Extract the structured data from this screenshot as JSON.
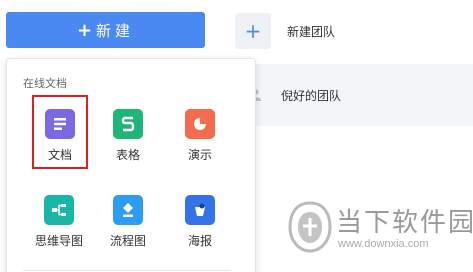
{
  "new_button": {
    "plus": "+",
    "label": "新建"
  },
  "dropdown": {
    "section_title": "在线文档",
    "items": [
      {
        "label": "文档",
        "icon": "doc-icon",
        "color": "#7b69e3"
      },
      {
        "label": "表格",
        "icon": "sheet-icon",
        "color": "#1fb576"
      },
      {
        "label": "演示",
        "icon": "slides-icon",
        "color": "#f26c4f"
      },
      {
        "label": "思维导图",
        "icon": "mindmap-icon",
        "color": "#17b6a5"
      },
      {
        "label": "流程图",
        "icon": "flowchart-icon",
        "color": "#2c9cf5"
      },
      {
        "label": "海报",
        "icon": "poster-icon",
        "color": "#3474e8"
      }
    ]
  },
  "teams": [
    {
      "name": "新建团队",
      "icon": "plus-icon"
    },
    {
      "name": "倪好的团队",
      "icon": "team-icon"
    }
  ],
  "watermark": {
    "title": "当下软件园",
    "url": "www.downxia.com"
  }
}
